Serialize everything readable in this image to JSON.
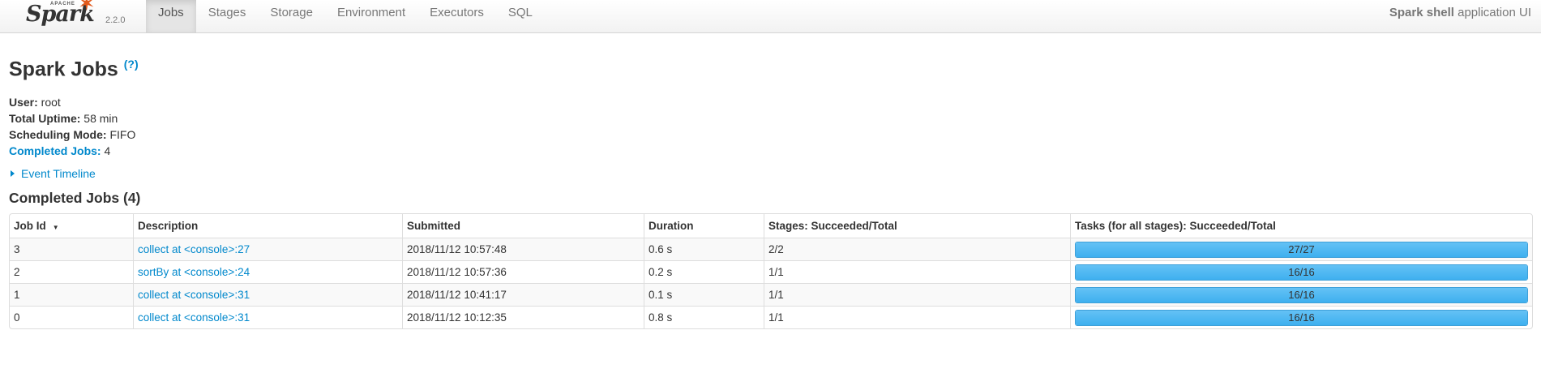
{
  "brand": {
    "apache": "APACHE",
    "name": "Spark",
    "version": "2.2.0"
  },
  "nav": {
    "tabs": [
      {
        "label": "Jobs",
        "active": true
      },
      {
        "label": "Stages"
      },
      {
        "label": "Storage"
      },
      {
        "label": "Environment"
      },
      {
        "label": "Executors"
      },
      {
        "label": "SQL"
      }
    ],
    "app_name": "Spark shell",
    "app_suffix": " application UI"
  },
  "page": {
    "title": "Spark Jobs ",
    "help": "(?)"
  },
  "summary": {
    "user_label": "User:",
    "user_value": " root",
    "uptime_label": "Total Uptime:",
    "uptime_value": " 58 min",
    "mode_label": "Scheduling Mode:",
    "mode_value": " FIFO",
    "completed_label": "Completed Jobs:",
    "completed_value": " 4"
  },
  "timeline": {
    "label": "Event Timeline"
  },
  "completed_jobs": {
    "title": "Completed Jobs (4)",
    "columns": {
      "job_id": "Job Id",
      "description": "Description",
      "submitted": "Submitted",
      "duration": "Duration",
      "stages": "Stages: Succeeded/Total",
      "tasks": "Tasks (for all stages): Succeeded/Total"
    },
    "rows": [
      {
        "job_id": "3",
        "description": "collect at <console>:27",
        "submitted": "2018/11/12 10:57:48",
        "duration": "0.6 s",
        "stages": "2/2",
        "tasks": "27/27",
        "progress": 1.0
      },
      {
        "job_id": "2",
        "description": "sortBy at <console>:24",
        "submitted": "2018/11/12 10:57:36",
        "duration": "0.2 s",
        "stages": "1/1",
        "tasks": "16/16",
        "progress": 1.0
      },
      {
        "job_id": "1",
        "description": "collect at <console>:31",
        "submitted": "2018/11/12 10:41:17",
        "duration": "0.1 s",
        "stages": "1/1",
        "tasks": "16/16",
        "progress": 1.0
      },
      {
        "job_id": "0",
        "description": "collect at <console>:31",
        "submitted": "2018/11/12 10:12:35",
        "duration": "0.8 s",
        "stages": "1/1",
        "tasks": "16/16",
        "progress": 1.0
      }
    ]
  },
  "colors": {
    "link": "#0088cc",
    "progress": "#3eb0ef",
    "spark_star": "#e25a1c"
  }
}
